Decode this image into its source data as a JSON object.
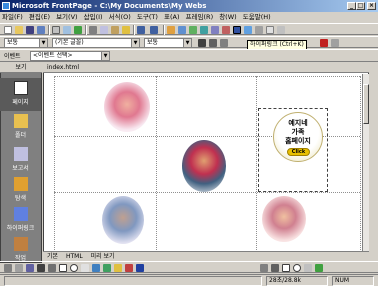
{
  "window": {
    "title": "Microsoft FrontPage - C:\\My Documents\\My Webs",
    "minimize": "_",
    "maximize": "□",
    "close": "×"
  },
  "menu": [
    "파일(F)",
    "편집(E)",
    "보기(V)",
    "삽입(I)",
    "서식(O)",
    "도구(T)",
    "표(A)",
    "프레임(R)",
    "창(W)",
    "도움말(H)"
  ],
  "format_bar": {
    "style": "보통",
    "font": "(기본 글꼴)",
    "size": "보통"
  },
  "event_bar": {
    "label": "이벤트",
    "combo": "<이벤트 선택>"
  },
  "tooltip": "하이퍼링크 (Ctrl+K)",
  "views": {
    "title": "보기",
    "items": [
      "페이지",
      "폴더",
      "보고서",
      "탐색",
      "하이퍼링크",
      "작업"
    ]
  },
  "document": {
    "tab": "index.html",
    "badge_lines": [
      "예지네",
      "가족",
      "홈페이지"
    ],
    "badge_button": "Click"
  },
  "bottom_tabs": [
    "기본",
    "HTML",
    "미리 보기"
  ],
  "status": {
    "time": "28초/28.8k",
    "mode": "NUM"
  },
  "colors": {
    "titlebar_start": "#0a246a",
    "titlebar_end": "#a6caf0",
    "views_bg": "#808080",
    "badge_button": "#e8c000"
  }
}
